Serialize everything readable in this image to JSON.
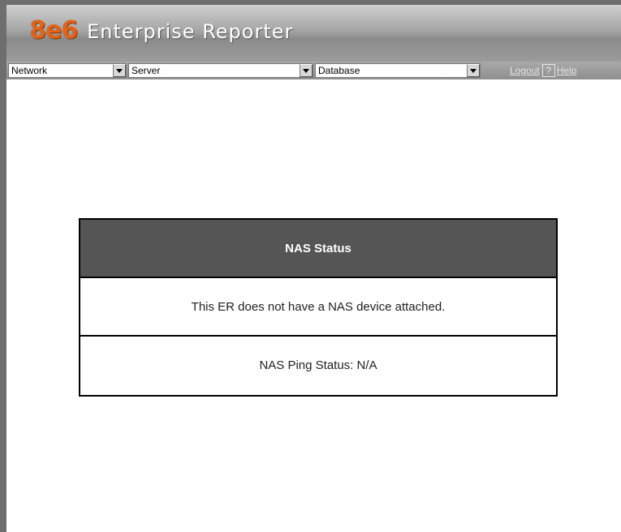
{
  "app": {
    "logo": "8e6",
    "title": "Enterprise Reporter"
  },
  "toolbar": {
    "network_select": "Network",
    "server_select": "Server",
    "database_select": "Database",
    "logout_label": "Logout",
    "help_icon": "?",
    "help_label": "Help"
  },
  "nas": {
    "heading": "NAS Status",
    "message": "This ER does not have a NAS device attached.",
    "ping_status": "NAS Ping Status: N/A"
  },
  "colors": {
    "brand_orange": "#e0641a",
    "header_gray": "#555555"
  },
  "icons": [
    "dropdown-arrow-icon",
    "help-icon"
  ]
}
